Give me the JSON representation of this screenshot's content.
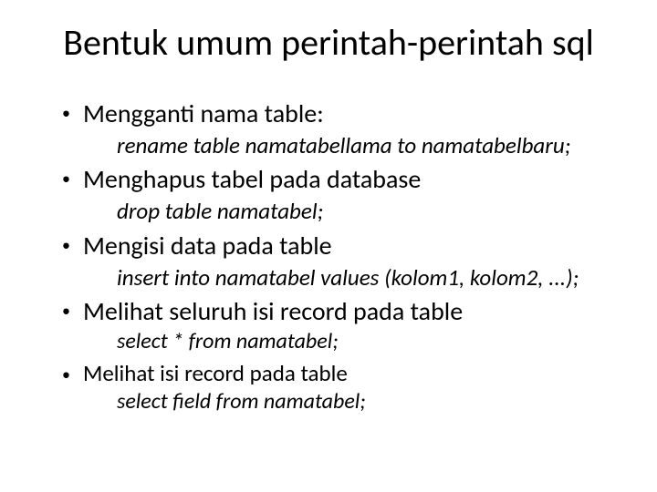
{
  "title": "Bentuk umum perintah-perintah sql",
  "items": [
    {
      "label": "Mengganti nama table:",
      "code": "rename table namatabellama to namatabelbaru;",
      "size": "large"
    },
    {
      "label": "Menghapus tabel pada database",
      "code": "drop table namatabel;",
      "size": "large"
    },
    {
      "label": "Mengisi data pada table",
      "code": "insert into namatabel values (kolom1, kolom2, ...);",
      "size": "large"
    },
    {
      "label": "Melihat seluruh isi record pada table",
      "code": "select * from namatabel;",
      "size": "large"
    },
    {
      "label": "Melihat isi record pada table",
      "code": "select field from namatabel;",
      "size": "small"
    }
  ]
}
